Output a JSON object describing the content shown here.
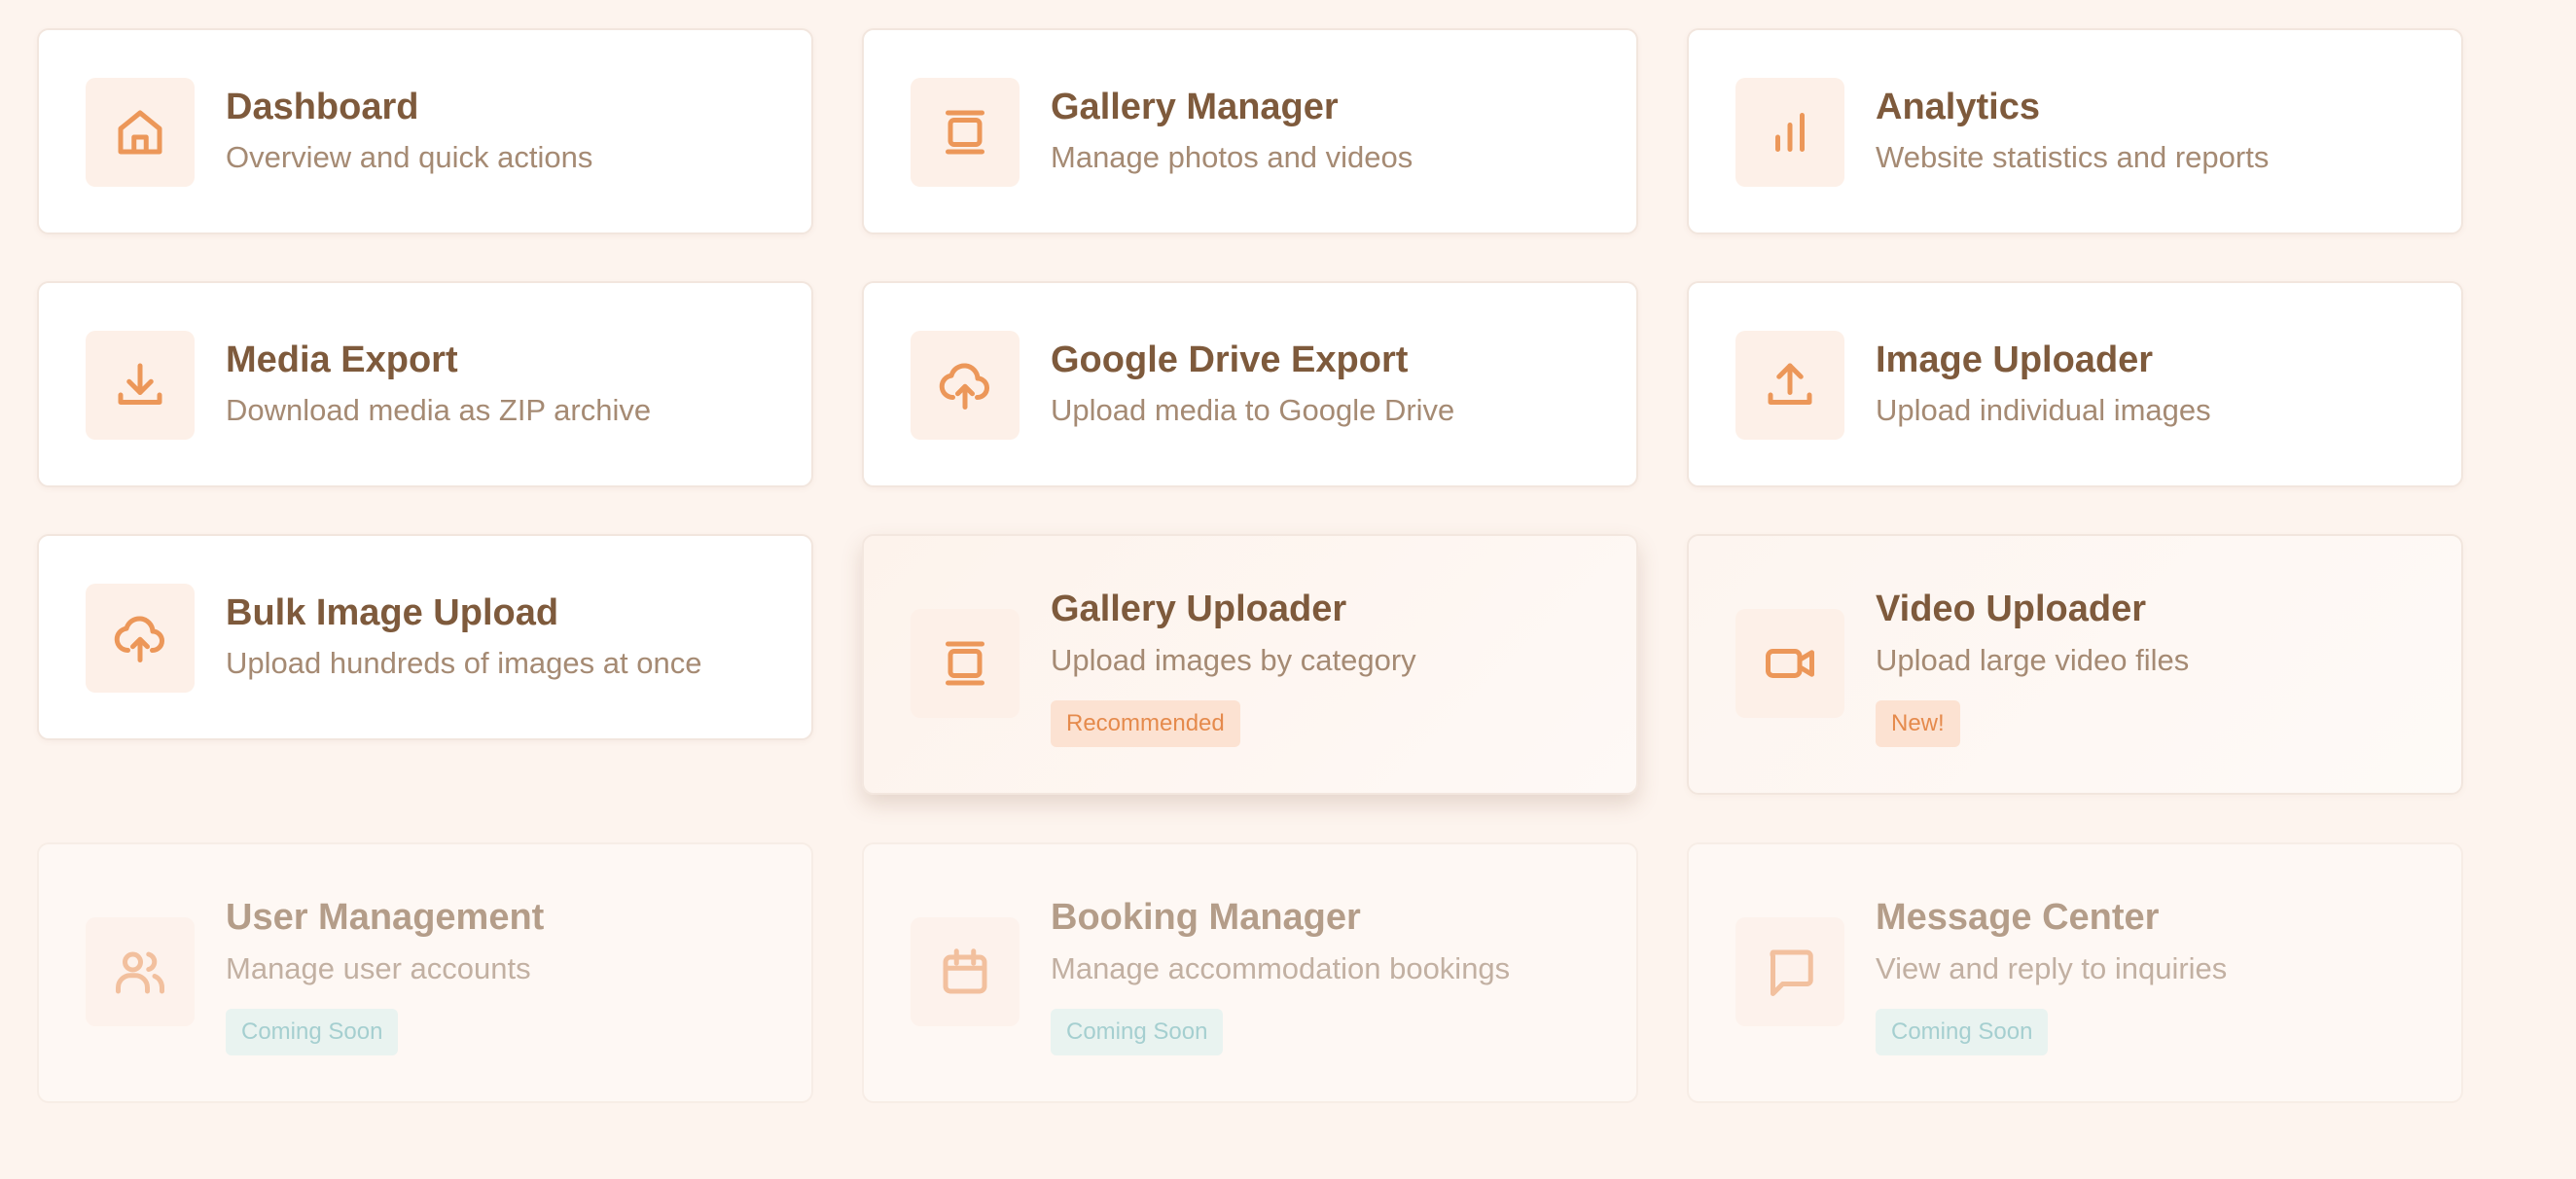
{
  "colors": {
    "page_background": "#fdf4ee",
    "accent_orange": "#ec9759",
    "title_brown": "#7e5a3c",
    "description_tan": "#a58a73",
    "badge_orange_bg": "#fce2d2",
    "badge_teal_bg": "#e9f3f0",
    "badge_teal_text": "#a5cfd0"
  },
  "cards": [
    {
      "title": "Dashboard",
      "description": "Overview and quick actions",
      "icon": "home-icon"
    },
    {
      "title": "Gallery Manager",
      "description": "Manage photos and videos",
      "icon": "gallery-icon"
    },
    {
      "title": "Analytics",
      "description": "Website statistics and reports",
      "icon": "bar-chart-icon"
    },
    {
      "title": "Media Export",
      "description": "Download media as ZIP archive",
      "icon": "download-icon"
    },
    {
      "title": "Google Drive Export",
      "description": "Upload media to Google Drive",
      "icon": "cloud-upload-icon"
    },
    {
      "title": "Image Uploader",
      "description": "Upload individual images",
      "icon": "upload-icon"
    },
    {
      "title": "Bulk Image Upload",
      "description": "Upload hundreds of images at once",
      "icon": "cloud-upload-icon"
    },
    {
      "title": "Gallery Uploader",
      "description": "Upload images by category",
      "icon": "gallery-icon",
      "badge": "Recommended"
    },
    {
      "title": "Video Uploader",
      "description": "Upload large video files",
      "icon": "video-icon",
      "badge": "New!"
    },
    {
      "title": "User Management",
      "description": "Manage user accounts",
      "icon": "users-icon",
      "badge": "Coming Soon",
      "disabled": true
    },
    {
      "title": "Booking Manager",
      "description": "Manage accommodation bookings",
      "icon": "calendar-icon",
      "badge": "Coming Soon",
      "disabled": true
    },
    {
      "title": "Message Center",
      "description": "View and reply to inquiries",
      "icon": "message-icon",
      "badge": "Coming Soon",
      "disabled": true
    }
  ]
}
